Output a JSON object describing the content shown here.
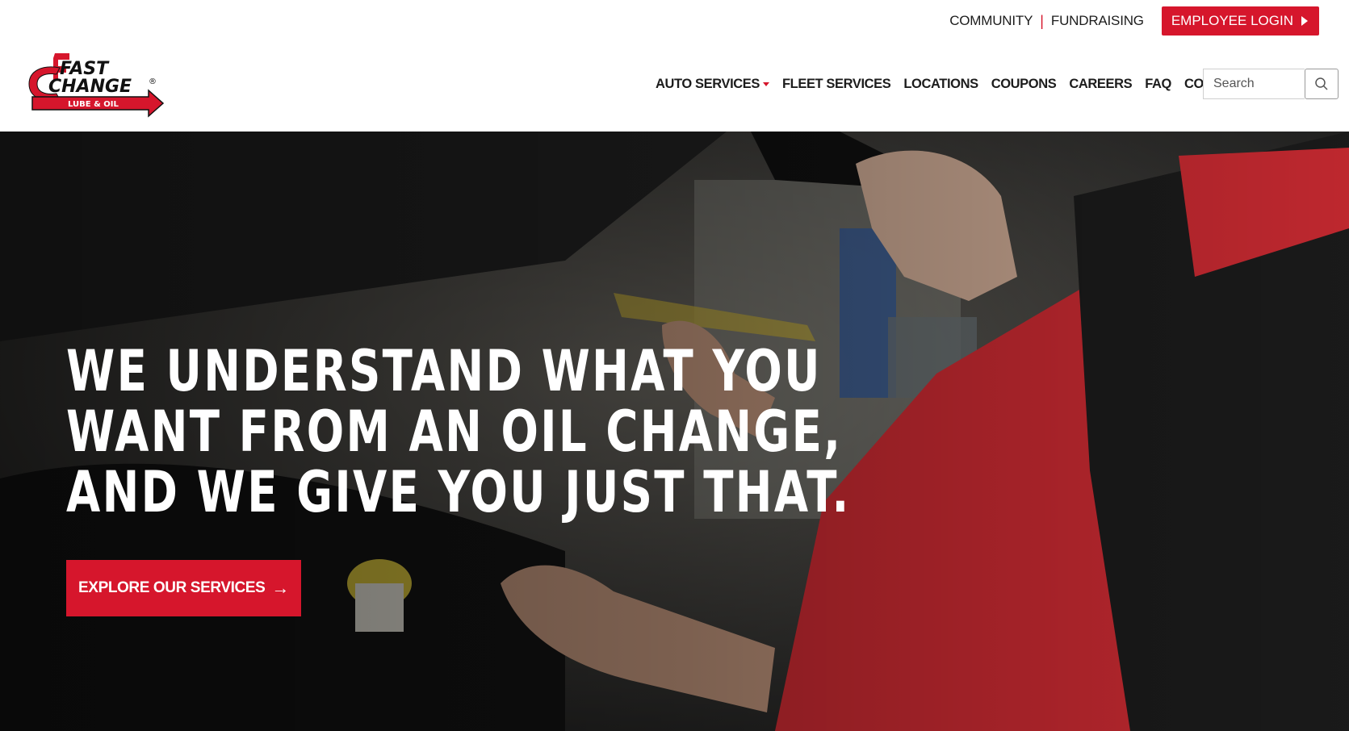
{
  "utility": {
    "community": "COMMUNITY",
    "separator": "|",
    "fundraising": "FUNDRAISING",
    "login_label": "EMPLOYEE LOGIN"
  },
  "logo": {
    "text_fast": "FAST",
    "text_change": "CHANGE",
    "text_sub": "LUBE & OIL",
    "registered": "®"
  },
  "nav": {
    "items": [
      {
        "label": "AUTO SERVICES",
        "dropdown": true
      },
      {
        "label": "FLEET SERVICES"
      },
      {
        "label": "LOCATIONS"
      },
      {
        "label": "COUPONS"
      },
      {
        "label": "CAREERS"
      },
      {
        "label": "FAQ"
      },
      {
        "label": "CONTACT US"
      }
    ]
  },
  "search": {
    "placeholder": "Search",
    "icon": "search-icon"
  },
  "hero": {
    "headline_lines": [
      "WE UNDERSTAND WHAT YOU",
      "WANT FROM AN OIL CHANGE,",
      "AND WE GIVE YOU JUST THAT."
    ],
    "cta_label": "EXPLORE OUR SERVICES",
    "cta_arrow": "→",
    "background": "mechanic working on car engine photo"
  },
  "colors": {
    "brand_red": "#d6162c",
    "text_dark": "#1c1c1c"
  }
}
